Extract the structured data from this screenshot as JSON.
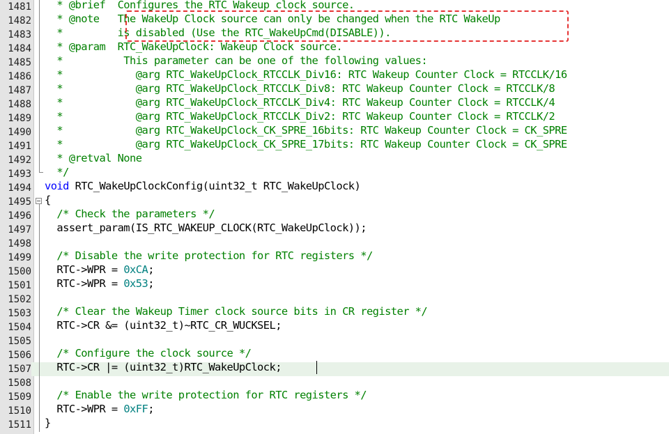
{
  "editor": {
    "lines": [
      {
        "num": "1481",
        "segs": [
          {
            "c": "c",
            "t": "  * @brief  Configures the RTC Wakeup clock source."
          }
        ]
      },
      {
        "num": "1482",
        "segs": [
          {
            "c": "c",
            "t": "  * @note   The WakeUp Clock source can only be changed when the RTC WakeUp"
          }
        ]
      },
      {
        "num": "1483",
        "segs": [
          {
            "c": "c",
            "t": "  *         is disabled (Use the RTC_WakeUpCmd(DISABLE))."
          }
        ]
      },
      {
        "num": "1484",
        "segs": [
          {
            "c": "c",
            "t": "  * @param  RTC_WakeUpClock: Wakeup Clock source."
          }
        ]
      },
      {
        "num": "1485",
        "segs": [
          {
            "c": "c",
            "t": "  *          This parameter can be one of the following values:"
          }
        ]
      },
      {
        "num": "1486",
        "segs": [
          {
            "c": "c",
            "t": "  *            @arg RTC_WakeUpClock_RTCCLK_Div16: RTC Wakeup Counter Clock = RTCCLK/16"
          }
        ]
      },
      {
        "num": "1487",
        "segs": [
          {
            "c": "c",
            "t": "  *            @arg RTC_WakeUpClock_RTCCLK_Div8: RTC Wakeup Counter Clock = RTCCLK/8"
          }
        ]
      },
      {
        "num": "1488",
        "segs": [
          {
            "c": "c",
            "t": "  *            @arg RTC_WakeUpClock_RTCCLK_Div4: RTC Wakeup Counter Clock = RTCCLK/4"
          }
        ]
      },
      {
        "num": "1489",
        "segs": [
          {
            "c": "c",
            "t": "  *            @arg RTC_WakeUpClock_RTCCLK_Div2: RTC Wakeup Counter Clock = RTCCLK/2"
          }
        ]
      },
      {
        "num": "1490",
        "segs": [
          {
            "c": "c",
            "t": "  *            @arg RTC_WakeUpClock_CK_SPRE_16bits: RTC Wakeup Counter Clock = CK_SPRE"
          }
        ]
      },
      {
        "num": "1491",
        "segs": [
          {
            "c": "c",
            "t": "  *            @arg RTC_WakeUpClock_CK_SPRE_17bits: RTC Wakeup Counter Clock = CK_SPRE"
          }
        ]
      },
      {
        "num": "1492",
        "segs": [
          {
            "c": "c",
            "t": "  * @retval None"
          }
        ]
      },
      {
        "num": "1493",
        "segs": [
          {
            "c": "c",
            "t": "  */"
          }
        ]
      },
      {
        "num": "1494",
        "segs": [
          {
            "c": "k",
            "t": "void"
          },
          {
            "c": "p",
            "t": " RTC_WakeUpClockConfig(uint32_t RTC_WakeUpClock)"
          }
        ]
      },
      {
        "num": "1495",
        "segs": [
          {
            "c": "p",
            "t": "{"
          }
        ]
      },
      {
        "num": "1496",
        "segs": [
          {
            "c": "c",
            "t": "  /* Check the parameters */"
          }
        ]
      },
      {
        "num": "1497",
        "segs": [
          {
            "c": "p",
            "t": "  assert_param(IS_RTC_WAKEUP_CLOCK(RTC_WakeUpClock));"
          }
        ]
      },
      {
        "num": "1498",
        "segs": []
      },
      {
        "num": "1499",
        "segs": [
          {
            "c": "c",
            "t": "  /* Disable the write protection for RTC registers */"
          }
        ]
      },
      {
        "num": "1500",
        "segs": [
          {
            "c": "p",
            "t": "  RTC->WPR = "
          },
          {
            "c": "n",
            "t": "0xCA"
          },
          {
            "c": "p",
            "t": ";"
          }
        ]
      },
      {
        "num": "1501",
        "segs": [
          {
            "c": "p",
            "t": "  RTC->WPR = "
          },
          {
            "c": "n",
            "t": "0x53"
          },
          {
            "c": "p",
            "t": ";"
          }
        ]
      },
      {
        "num": "1502",
        "segs": []
      },
      {
        "num": "1503",
        "segs": [
          {
            "c": "c",
            "t": "  /* Clear the Wakeup Timer clock source bits in CR register */"
          }
        ]
      },
      {
        "num": "1504",
        "segs": [
          {
            "c": "p",
            "t": "  RTC->CR &= (uint32_t)~RTC_CR_WUCKSEL;"
          }
        ]
      },
      {
        "num": "1505",
        "segs": []
      },
      {
        "num": "1506",
        "segs": [
          {
            "c": "c",
            "t": "  /* Configure the clock source */"
          }
        ]
      },
      {
        "num": "1507",
        "segs": [
          {
            "c": "p",
            "t": "  RTC->CR |= (uint32_t)RTC_WakeUpClock;"
          }
        ],
        "current": true
      },
      {
        "num": "1508",
        "segs": []
      },
      {
        "num": "1509",
        "segs": [
          {
            "c": "c",
            "t": "  /* Enable the write protection for RTC registers */"
          }
        ]
      },
      {
        "num": "1510",
        "segs": [
          {
            "c": "p",
            "t": "  RTC->WPR = "
          },
          {
            "c": "n",
            "t": "0xFF"
          },
          {
            "c": "p",
            "t": ";"
          }
        ]
      },
      {
        "num": "1511",
        "segs": [
          {
            "c": "p",
            "t": "}"
          }
        ]
      }
    ]
  },
  "colors": {
    "comment": "#008000",
    "keyword": "#0000ff",
    "number": "#008080",
    "plain": "#000000",
    "gutter": "#e4e4e4",
    "current_line": "#e8f2e8",
    "highlight_box": "#e53333"
  }
}
